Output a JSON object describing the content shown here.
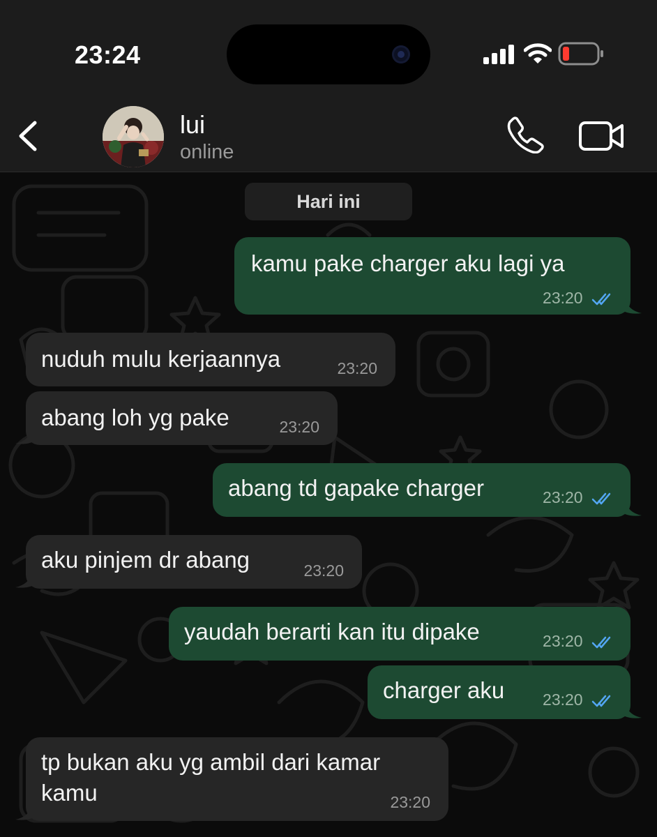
{
  "status_bar": {
    "time": "23:24"
  },
  "header": {
    "contact_name": "lui",
    "contact_status": "online",
    "icons": [
      "chevron-left-icon",
      "phone-icon",
      "video-camera-icon"
    ]
  },
  "chat": {
    "date_divider": "Hari ini",
    "messages": [
      {
        "direction": "out",
        "text": "kamu pake charger aku lagi ya",
        "time": "23:20",
        "read": true
      },
      {
        "direction": "in",
        "text": "nuduh mulu kerjaannya",
        "time": "23:20"
      },
      {
        "direction": "in",
        "text": "abang loh yg pake",
        "time": "23:20"
      },
      {
        "direction": "out",
        "text": "abang td gapake charger",
        "time": "23:20",
        "read": true
      },
      {
        "direction": "in",
        "text": "aku pinjem dr abang",
        "time": "23:20"
      },
      {
        "direction": "out",
        "text": "yaudah berarti kan itu dipake",
        "time": "23:20",
        "read": true
      },
      {
        "direction": "out",
        "text": "charger aku",
        "time": "23:20",
        "read": true
      },
      {
        "direction": "in",
        "text": "tp bukan aku yg ambil dari kamar kamu",
        "time": "23:20"
      }
    ]
  },
  "colors": {
    "outgoing_bubble": "#1d4a32",
    "incoming_bubble": "#262626",
    "read_ticks": "#53a6f2",
    "battery_low": "#ff3b30"
  }
}
